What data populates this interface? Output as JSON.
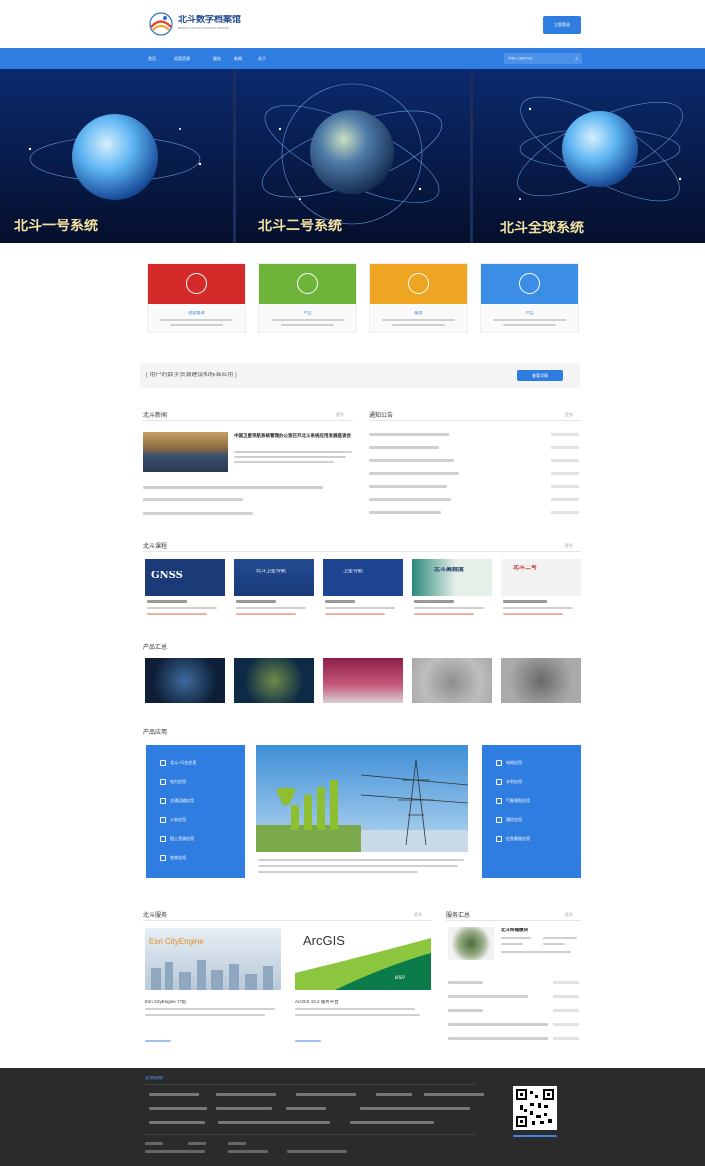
{
  "header": {
    "logo_text": "北斗数字档案馆",
    "logo_sub": "BEIDOU DIGITAL ARCHIVE CENTER",
    "action_button": "立即登录"
  },
  "nav": {
    "items": [
      "首页",
      "档案资源",
      "服务",
      "新闻",
      "关于"
    ],
    "search_placeholder": "请输入搜索内容"
  },
  "banner": {
    "panels": [
      "北斗一号系统",
      "北斗二号系统",
      "北斗全球系统"
    ]
  },
  "features": [
    {
      "title": "档案查询",
      "color": "#d42a2a",
      "icon": "archive-icon"
    },
    {
      "title": "产品",
      "color": "#6fb43a",
      "icon": "product-icon"
    },
    {
      "title": "服务",
      "color": "#eea522",
      "icon": "home-icon"
    },
    {
      "title": "产品",
      "color": "#3b8de6",
      "icon": "eye-icon"
    }
  ],
  "notice": {
    "text": "[ 用户的数字资源建设和标准应用 ]",
    "button": "查看详情"
  },
  "news": {
    "left_title": "北斗新闻",
    "left_more": "更多",
    "headline": "中国卫星导航系统管理办公室召开北斗系统应用发展座谈会",
    "right_title": "通知公告",
    "right_more": "更多"
  },
  "cases": {
    "title": "北斗课程",
    "more": "更多",
    "items": [
      "GNSS",
      "北斗卫星导航",
      "卫星导航",
      "北斗高精度",
      "北斗二号"
    ]
  },
  "products": {
    "title": "产品汇总"
  },
  "solutions": {
    "title": "产品应用",
    "left_menu": [
      "北斗+行业应用",
      "电力应用",
      "交通运输应用",
      "公安应用",
      "国土资源应用",
      "农林应用"
    ],
    "right_menu": [
      "电网应用",
      "水利应用",
      "气象预报应用",
      "通信应用",
      "应急救援应用"
    ]
  },
  "bottom": {
    "left_title": "北斗服务",
    "left_more": "更多",
    "card1_title": "Esri CityEngine",
    "card1_caption": "Esri CityEngine 介绍",
    "card2_title": "ArcGIS",
    "card2_sub": "esri",
    "card2_caption": "ArcGIS 10.2 服务平台",
    "right_title": "服务汇总",
    "right_more": "更多",
    "product_title": "北斗终端模块"
  },
  "footer": {
    "title": "友情链接"
  }
}
